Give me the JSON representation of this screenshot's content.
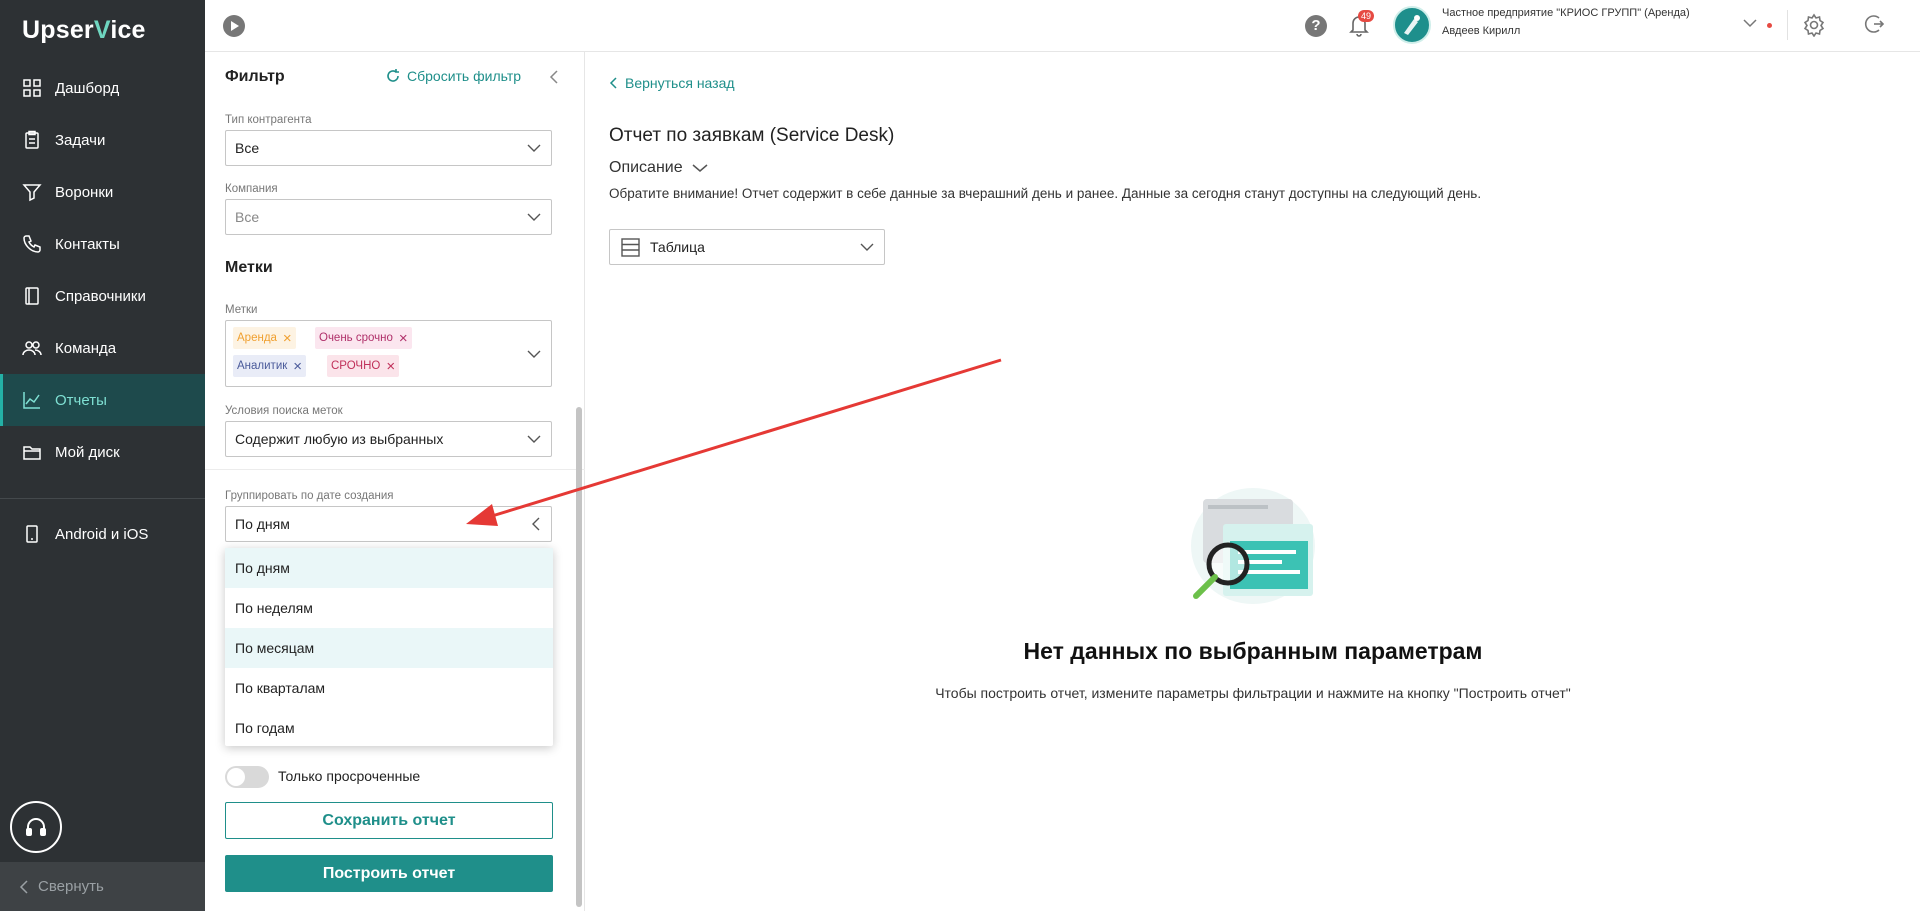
{
  "app": {
    "logo_left": "Upser",
    "logo_v": "V",
    "logo_right": "ice"
  },
  "sidebar": {
    "items": [
      {
        "label": "Дашборд",
        "icon": "dashboard-icon"
      },
      {
        "label": "Задачи",
        "icon": "tasks-icon"
      },
      {
        "label": "Воронки",
        "icon": "funnel-icon"
      },
      {
        "label": "Контакты",
        "icon": "contacts-icon"
      },
      {
        "label": "Справочники",
        "icon": "book-icon"
      },
      {
        "label": "Команда",
        "icon": "team-icon"
      },
      {
        "label": "Отчеты",
        "icon": "chart-icon",
        "active": true
      },
      {
        "label": "Мой диск",
        "icon": "folder-icon"
      },
      {
        "label": "Android и iOS",
        "icon": "mobile-icon"
      }
    ],
    "collapse_label": "Свернуть"
  },
  "topbar": {
    "notifications": "49",
    "company": "Частное предприятие \"КРИОС ГРУПП\" (Аренда)",
    "user": "Авдеев Кирилл"
  },
  "filter": {
    "title": "Фильтр",
    "reset_label": "Сбросить фильтр",
    "contractor_type": {
      "label": "Тип контрагента",
      "value": "Все"
    },
    "company": {
      "label": "Компания",
      "value": "Все"
    },
    "tags_section": "Метки",
    "tags": {
      "label": "Метки",
      "items": [
        {
          "text": "Аренда",
          "color": "#f0a030",
          "bg": "#fdf3e3"
        },
        {
          "text": "Очень срочно",
          "color": "#b0306a",
          "bg": "#fbe6ef"
        },
        {
          "text": "Аналитик",
          "color": "#4a5a9a",
          "bg": "#e9ecf7"
        },
        {
          "text": "СРОЧНО",
          "color": "#c0305a",
          "bg": "#fbe4ea"
        }
      ]
    },
    "tag_condition": {
      "label": "Условия поиска меток",
      "value": "Содержит любую из выбранных"
    },
    "group_by": {
      "label": "Группировать по дате создания",
      "value": "По дням",
      "options": [
        "По дням",
        "По неделям",
        "По месяцам",
        "По кварталам",
        "По годам"
      ]
    },
    "overdue_only": "Только просроченные",
    "save_label": "Сохранить отчет",
    "build_label": "Построить отчет"
  },
  "main": {
    "back_label": "Вернуться назад",
    "title": "Отчет по заявкам (Service Desk)",
    "description_label": "Описание",
    "note": "Обратите внимание! Отчет содержит в себе данные за вчерашний день и ранее. Данные за сегодня станут доступны на следующий день.",
    "view_mode": "Таблица",
    "empty_title": "Нет данных по выбранным параметрам",
    "empty_text": "Чтобы построить отчет, измените параметры фильтрации и нажмите на кнопку \"Построить отчет\""
  },
  "colors": {
    "accent": "#1f8f8a",
    "sidebar_bg": "#2d3134",
    "annotation_arrow": "#e53935"
  }
}
